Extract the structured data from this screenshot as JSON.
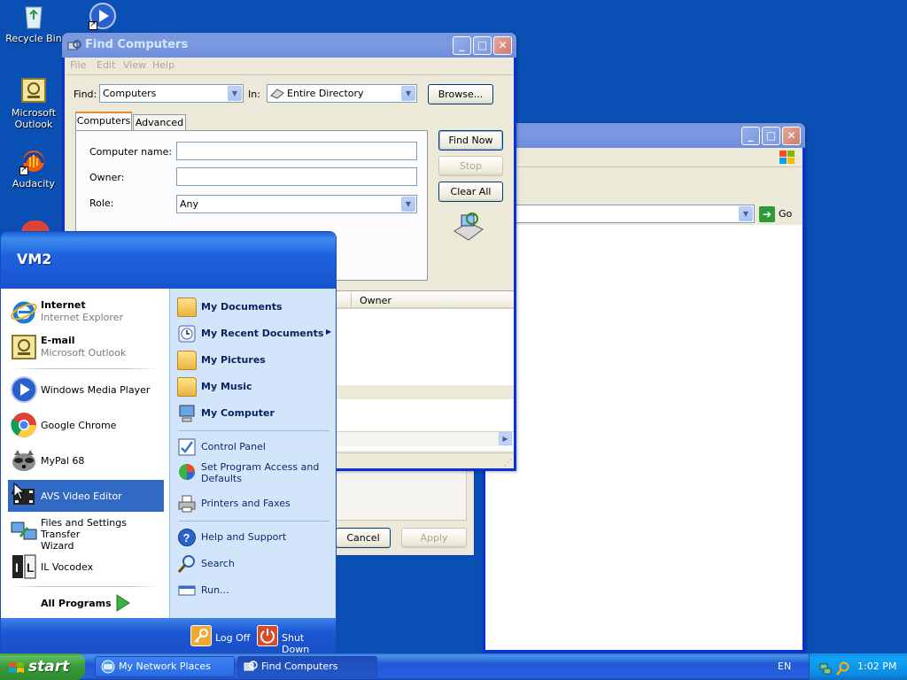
{
  "desktop": {
    "icons": [
      {
        "label": "Recycle Bin",
        "icon": "recycle-bin-icon"
      },
      {
        "label": "Microsoft\nOutlook",
        "icon": "outlook-icon"
      },
      {
        "label": "Audacity",
        "icon": "audacity-icon"
      },
      {
        "label": "",
        "icon": "media-player-shortcut-icon"
      }
    ]
  },
  "back_window": {
    "go_label": "Go"
  },
  "props_window": {
    "cancel_label": "Cancel",
    "apply_label": "Apply"
  },
  "find_window": {
    "title": "Find Computers",
    "menu": [
      "File",
      "Edit",
      "View",
      "Help"
    ],
    "find_label": "Find:",
    "find_value": "Computers",
    "in_label": "In:",
    "in_value": "Entire Directory",
    "browse_label": "Browse...",
    "tabs": [
      "Computers",
      "Advanced"
    ],
    "computer_name_label": "Computer name:",
    "owner_label": "Owner:",
    "role_label": "Role:",
    "role_value": "Any",
    "find_now_label": "Find Now",
    "stop_label": "Stop",
    "clear_all_label": "Clear All",
    "results_columns": [
      "Owner"
    ]
  },
  "start_menu": {
    "user": "VM2",
    "pinned": [
      {
        "title": "Internet",
        "subtitle": "Internet Explorer"
      },
      {
        "title": "E-mail",
        "subtitle": "Microsoft Outlook"
      }
    ],
    "recent": [
      "Windows Media Player",
      "Google Chrome",
      "MyPal 68",
      "AVS Video Editor",
      "Files and Settings Transfer\nWizard",
      "IL Vocodex"
    ],
    "all_programs": "All Programs",
    "right_items_main": [
      "My Documents",
      "My Recent Documents",
      "My Pictures",
      "My Music",
      "My Computer"
    ],
    "right_items_system": [
      "Control Panel",
      "Set Program Access and\nDefaults",
      "Printers and Faxes"
    ],
    "right_items_help": [
      "Help and Support",
      "Search",
      "Run..."
    ],
    "log_off": "Log Off",
    "shut_down": "Shut Down"
  },
  "taskbar": {
    "start_label": "start",
    "tasks": [
      "My Network Places",
      "Find Computers"
    ],
    "language": "EN",
    "clock": "1:02 PM"
  }
}
